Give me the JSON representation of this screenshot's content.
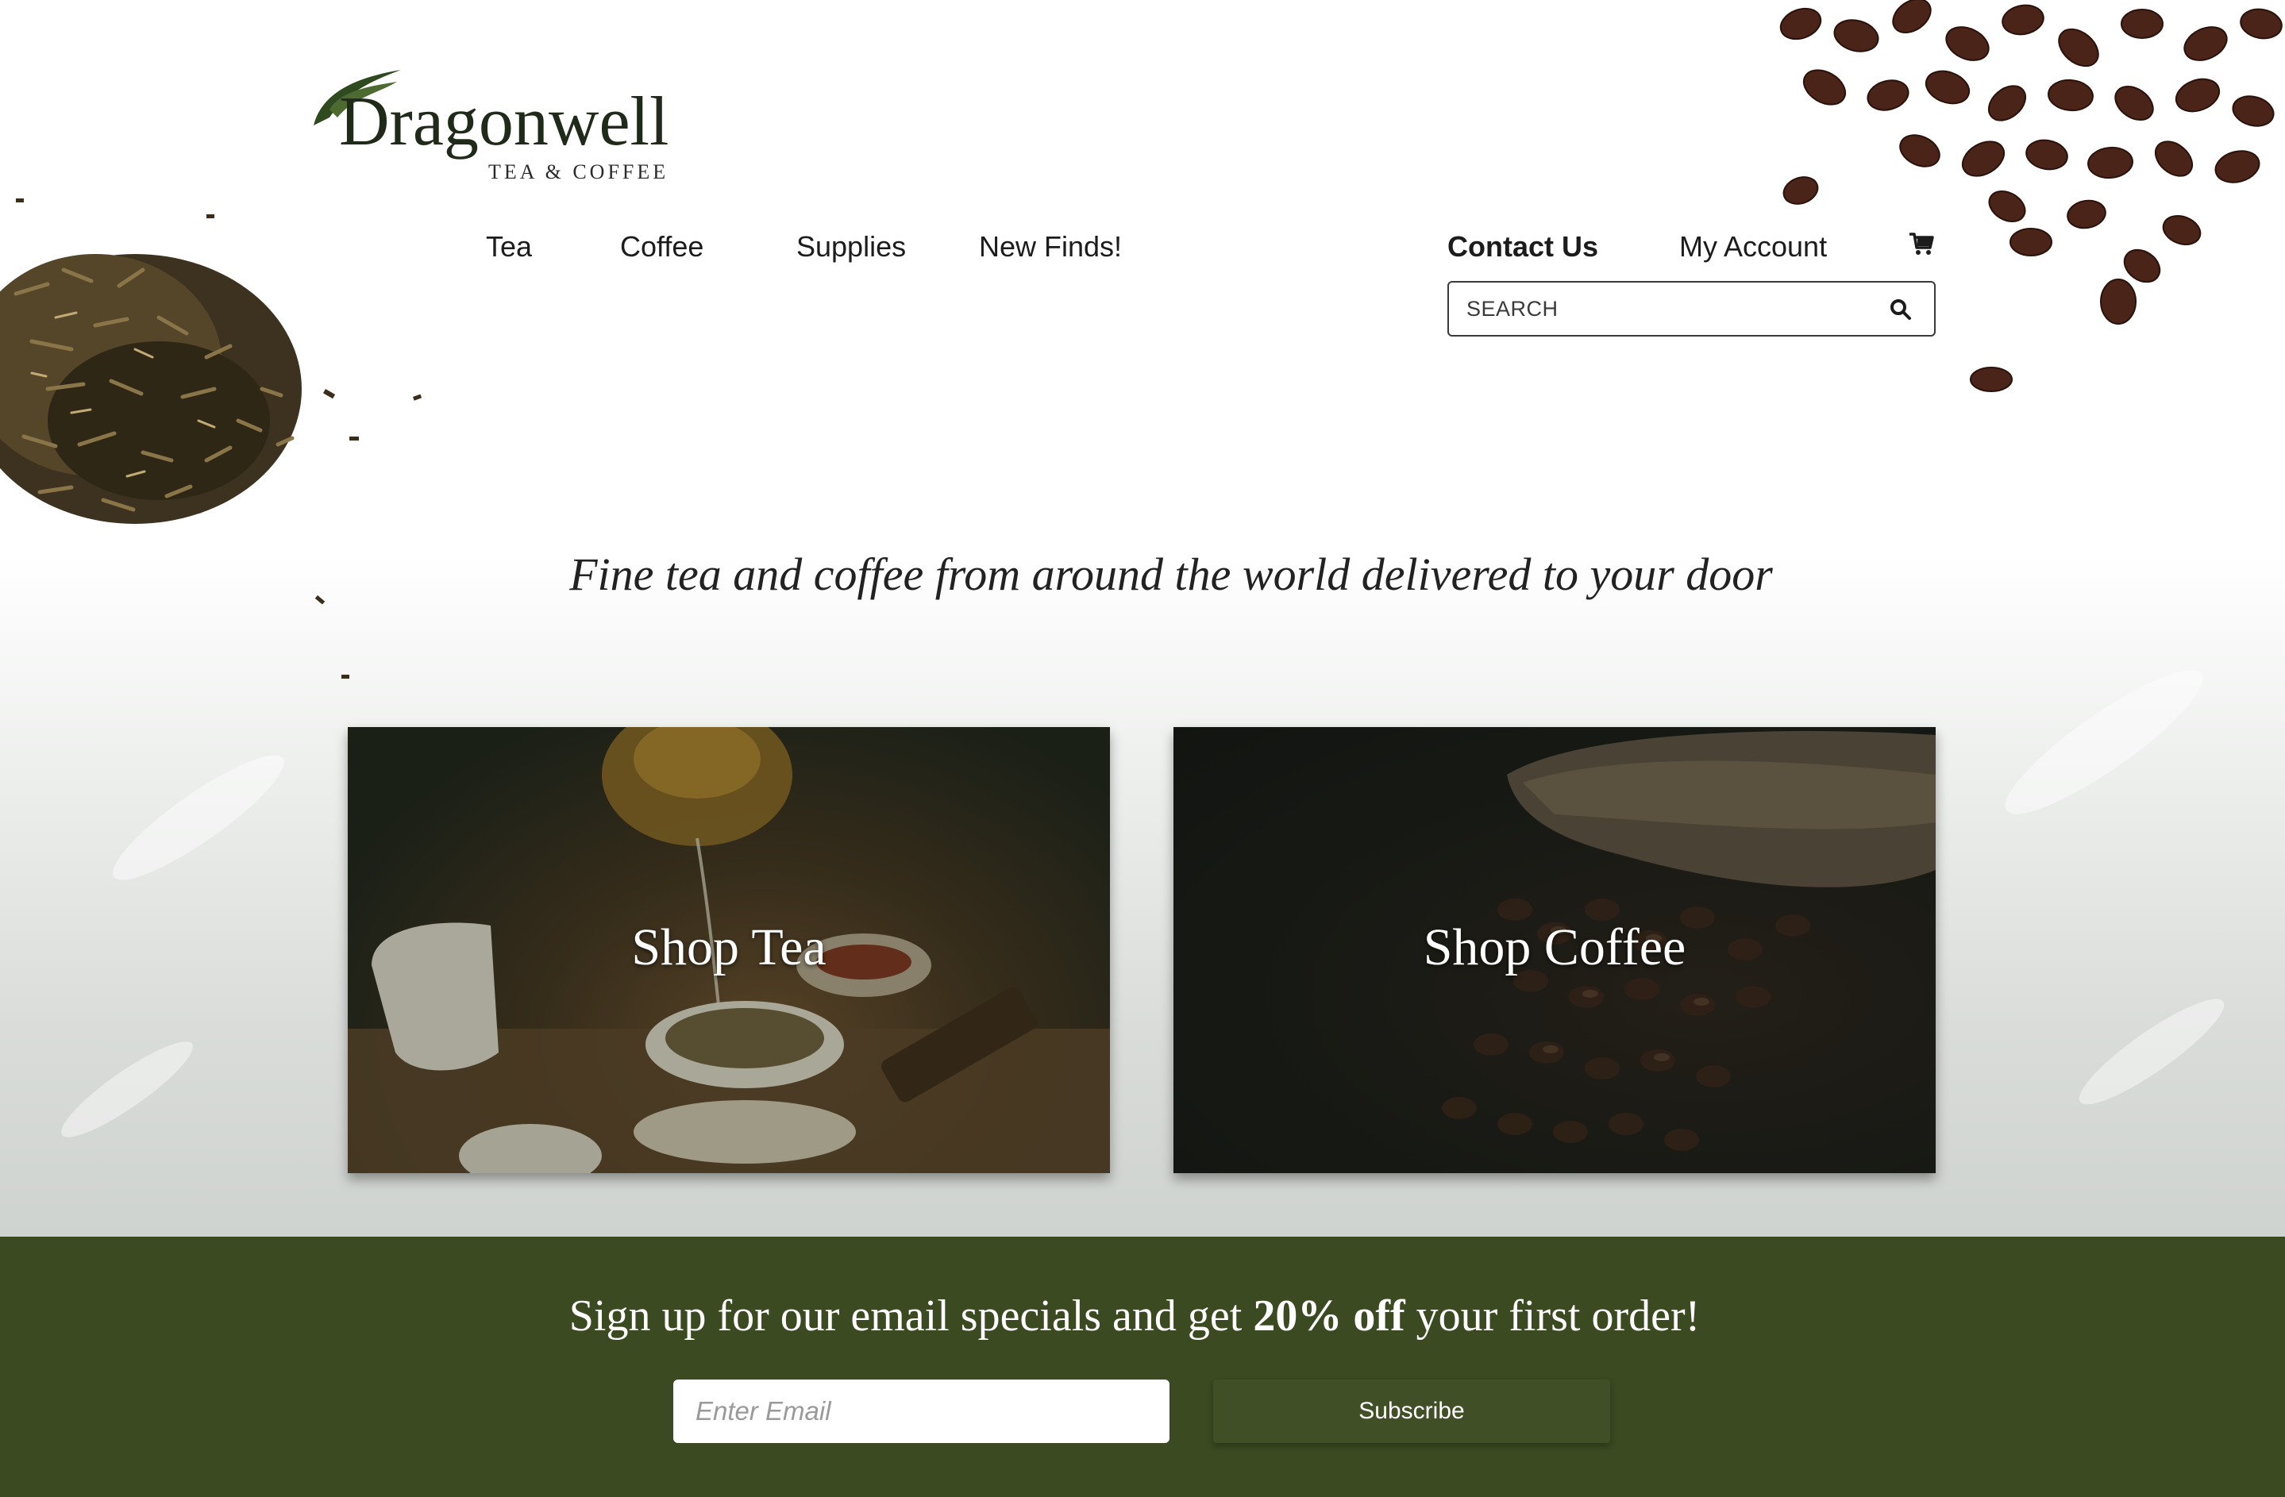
{
  "brand": {
    "name": "Dragonwell",
    "subtitle": "TEA & COFFEE",
    "accent_color": "#2f4a1e"
  },
  "nav": {
    "items": [
      {
        "label": "Tea"
      },
      {
        "label": "Coffee"
      },
      {
        "label": "Supplies"
      },
      {
        "label": "New Finds!"
      }
    ]
  },
  "utility": {
    "contact_label": "Contact Us",
    "account_label": "My Account",
    "cart_icon": "cart-icon"
  },
  "search": {
    "placeholder": "SEARCH",
    "icon": "search-icon"
  },
  "hero": {
    "tagline": "Fine tea and coffee from around the world delivered to your door"
  },
  "cards": [
    {
      "label": "Shop Tea"
    },
    {
      "label": "Shop Coffee"
    }
  ],
  "newsletter": {
    "text_before": "Sign up for our email specials and get ",
    "text_bold": "20% off",
    "text_after": " your first order!",
    "email_placeholder": "Enter Email",
    "subscribe_label": "Subscribe",
    "background_color": "#3b4a21"
  }
}
